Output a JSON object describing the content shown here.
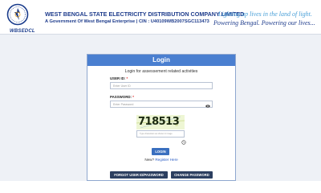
{
  "header": {
    "brand": "WBSEDCL",
    "company_name": "WEST BENGAL STATE ELECTRICITY DISTRIBUTION COMPANY LIMITED",
    "company_sub": "A Government Of West Bengal Enterprise | CIN : U40109WB2007SGC113473",
    "tagline_1": "Lighting up lives in the land of light.",
    "tagline_2": "Powering Bengal. Powering our lives..."
  },
  "login": {
    "title": "Login",
    "subtitle": "Login for assessement related activities",
    "user_id_label": "USER ID: ",
    "user_id_placeholder": "Enter User ID",
    "password_label": "PASSWORD: ",
    "password_placeholder": "Enter Password",
    "required_mark": "*",
    "captcha_text": "718513",
    "captcha_placeholder": "Type characters as shown in image",
    "login_button": "LOGIN",
    "new_text": "New?",
    "register_link": "Register Here",
    "forgot_button": "FORGOT USER ID/PASSWORD",
    "change_button": "CHANGE PASSWORD"
  },
  "colors": {
    "accent": "#4a7fd0",
    "button": "#3a6fbf",
    "dark_button": "#2c3f60",
    "brand": "#1e3c8c"
  },
  "icons": {
    "logo": "wbsedcl-logo",
    "password_toggle": "eye-icon",
    "captcha_refresh": "refresh-icon"
  }
}
